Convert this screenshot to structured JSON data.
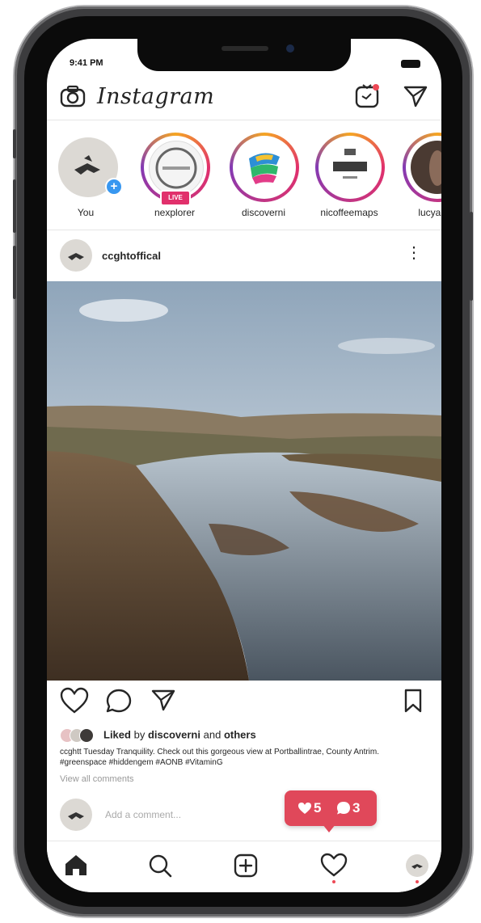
{
  "status_bar": {
    "time": "9:41 PM"
  },
  "header": {
    "logo": "Instagram"
  },
  "stories": [
    {
      "label": "You"
    },
    {
      "label": "nexplorer",
      "badge": "LIVE"
    },
    {
      "label": "discoverni"
    },
    {
      "label": "nicoffeemaps"
    },
    {
      "label": "lucyarbe"
    }
  ],
  "post": {
    "username": "ccghtoffical",
    "liked_by_prefix": "Liked",
    "liked_by_word": "by",
    "liked_by_user": "discoverni",
    "liked_and": "and",
    "liked_others": "others",
    "caption": "ccghtt Tuesday Tranquility. Check out this gorgeous view at Portballintrae, County Antrim. #greenspace #hiddengem #AONB #VitaminG",
    "view_all": "View all comments",
    "add_comment_placeholder": "Add a comment..."
  },
  "notification": {
    "likes": "5",
    "comments": "3",
    "color": "#e0485a"
  },
  "icons": {
    "camera": "camera-icon",
    "igtv": "igtv-icon",
    "direct": "paper-plane-icon",
    "like": "heart-icon",
    "comment": "comment-icon",
    "share": "paper-plane-icon",
    "save": "bookmark-icon",
    "home": "home-icon",
    "search": "search-icon",
    "add": "plus-square-icon",
    "activity": "heart-icon",
    "profile": "avatar"
  },
  "colors": {
    "accent": "#e1306c",
    "blue": "#3897f0"
  }
}
